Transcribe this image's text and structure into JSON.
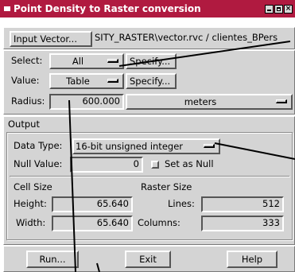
{
  "window": {
    "title": "Point Density to Raster conversion",
    "controls": {
      "minimize": "minimize-icon",
      "maximize": "maximize-icon",
      "close": "×"
    }
  },
  "input": {
    "button_label": "Input Vector...",
    "path": "SITY_RASTER\\vector.rvc / clientes_BPers"
  },
  "select": {
    "label": "Select:",
    "value": "All",
    "specify_label": "Specify..."
  },
  "value": {
    "label": "Value:",
    "value": "Table",
    "specify_label": "Specify..."
  },
  "radius": {
    "label": "Radius:",
    "value": "600.000",
    "unit": "meters"
  },
  "output": {
    "heading": "Output",
    "data_type": {
      "label": "Data Type:",
      "value": "16-bit unsigned integer"
    },
    "null_value": {
      "label": "Null Value:",
      "value": "0",
      "set_as_null_label": "Set as Null",
      "set_as_null_checked": false
    },
    "cell_size": {
      "heading": "Cell Size",
      "height_label": "Height:",
      "height_value": "65.640",
      "width_label": "Width:",
      "width_value": "65.640"
    },
    "raster_size": {
      "heading": "Raster Size",
      "lines_label": "Lines:",
      "lines_value": "512",
      "columns_label": "Columns:",
      "columns_value": "333"
    }
  },
  "buttons": {
    "run": "Run...",
    "exit": "Exit",
    "help": "Help"
  },
  "colors": {
    "titlebar": "#b01a40",
    "panel": "#d4d4d4",
    "callout_line": "#000000"
  }
}
